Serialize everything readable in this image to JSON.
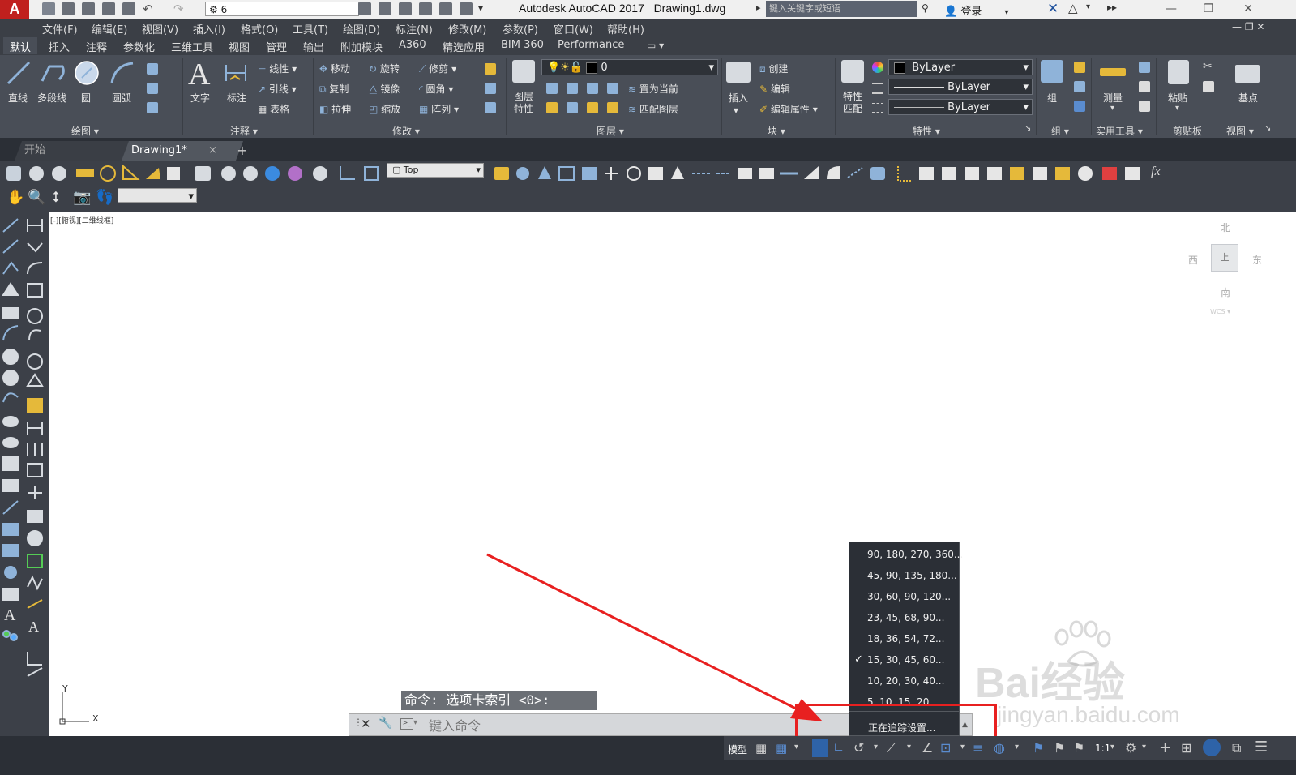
{
  "window": {
    "app_title": "Autodesk AutoCAD 2017",
    "doc_title": "Drawing1.dwg",
    "workspace_value": "6",
    "search_placeholder": "键入关键字或短语",
    "login_label": "登录"
  },
  "menu": [
    "文件(F)",
    "编辑(E)",
    "视图(V)",
    "插入(I)",
    "格式(O)",
    "工具(T)",
    "绘图(D)",
    "标注(N)",
    "修改(M)",
    "参数(P)",
    "窗口(W)",
    "帮助(H)"
  ],
  "ribbon_tabs": [
    "默认",
    "插入",
    "注释",
    "参数化",
    "三维工具",
    "视图",
    "管理",
    "输出",
    "附加模块",
    "A360",
    "精选应用",
    "BIM 360",
    "Performance"
  ],
  "ribbon": {
    "draw": {
      "title": "绘图",
      "line": "直线",
      "polyline": "多段线",
      "circle": "圆",
      "arc": "圆弧"
    },
    "annotate": {
      "title": "注释",
      "text": "文字",
      "dim": "标注",
      "linear": "线性",
      "leader": "引线",
      "table": "表格"
    },
    "modify": {
      "title": "修改",
      "move": "移动",
      "rotate": "旋转",
      "trim": "修剪",
      "copy": "复制",
      "mirror": "镜像",
      "fillet": "圆角",
      "stretch": "拉伸",
      "scale": "缩放",
      "array": "阵列"
    },
    "layers": {
      "title": "图层",
      "props": "图层\n特性",
      "props_l1": "图层",
      "props_l2": "特性",
      "layer_value": "0",
      "set_current": "置为当前",
      "match_layer": "匹配图层"
    },
    "block": {
      "title": "块",
      "insert": "插入",
      "create": "创建",
      "edit": "编辑",
      "edit_attr": "编辑属性"
    },
    "properties": {
      "title": "特性",
      "match_l1": "特性",
      "match_l2": "匹配",
      "color": "ByLayer",
      "linetype": "ByLayer",
      "lineweight": "ByLayer"
    },
    "groups": {
      "title": "组",
      "group": "组"
    },
    "utilities": {
      "title": "实用工具",
      "measure": "测量"
    },
    "clipboard": {
      "title": "剪贴板",
      "paste": "粘贴"
    },
    "view": {
      "title": "视图",
      "base": "基点"
    }
  },
  "file_tabs": {
    "start": "开始",
    "drawing": "Drawing1*",
    "add": "+"
  },
  "toolbar": {
    "view_combo": "Top"
  },
  "viewport": {
    "label": "[-][俯视][二维线框]"
  },
  "viewcube": {
    "north": "北",
    "south": "南",
    "west": "西",
    "east": "东",
    "face": "上",
    "wcs": "WCS"
  },
  "ucs": {
    "y": "Y",
    "x": "X"
  },
  "command": {
    "history": "命令:  选项卡索引 <0>:",
    "placeholder": "键入命令"
  },
  "polar_menu": {
    "items": [
      {
        "label": "90, 180, 270, 360...",
        "checked": false
      },
      {
        "label": "45, 90, 135, 180...",
        "checked": false
      },
      {
        "label": "30, 60, 90, 120...",
        "checked": false
      },
      {
        "label": "23, 45, 68, 90...",
        "checked": false
      },
      {
        "label": "18, 36, 54, 72...",
        "checked": false
      },
      {
        "label": "15, 30, 45, 60...",
        "checked": true
      },
      {
        "label": "10, 20, 30, 40...",
        "checked": false
      },
      {
        "label": "5, 10, 15, 20...",
        "checked": false
      }
    ],
    "settings": "正在追踪设置..."
  },
  "status": {
    "model": "模型",
    "scale": "1:1"
  },
  "watermark": {
    "brand": "Bai经验",
    "url": "jingyan.baidu.com"
  },
  "colors": {
    "accent_red": "#e82020",
    "autocad_red": "#c0201e",
    "ribbon_bg": "#494e57"
  }
}
